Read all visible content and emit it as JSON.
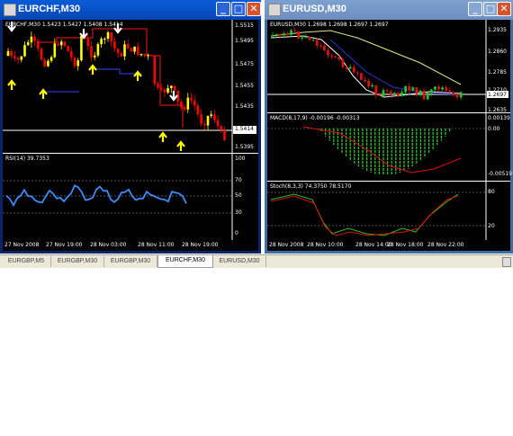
{
  "left_window": {
    "title": "EURCHF,M30",
    "price_pane": {
      "header": "EURCHF,M30  1.5423  1.5427  1.5408  1.5414",
      "price_axis": [
        "1.5515",
        "1.5495",
        "1.5475",
        "1.5455",
        "1.5435",
        "1.5414",
        "1.5395"
      ],
      "current_price": "1.5414"
    },
    "rsi_pane": {
      "header": "RSI(14) 39.7353",
      "axis": [
        "100",
        "70",
        "50",
        "30",
        "0"
      ]
    },
    "time_axis": [
      "27 Nov 2008",
      "27 Nov 19:00",
      "28 Nov 03:00",
      "28 Nov 11:00",
      "28 Nov 19:00"
    ]
  },
  "right_window": {
    "title": "EURUSD,M30",
    "price_pane": {
      "header": "EURUSD,M30  1.2698  1.2698  1.2697  1.2697",
      "price_axis": [
        "1.2935",
        "1.2860",
        "1.2785",
        "1.2710",
        "1.2697",
        "1.2635"
      ],
      "current_price": "1.2697"
    },
    "macd_pane": {
      "header": "MACD(8,17,9) -0.00196 -0.00313",
      "axis": [
        "0.00139",
        "0.00",
        "-0.00519"
      ]
    },
    "stoch_pane": {
      "header": "Stoch(8,3,3) 74.3750 78.5170",
      "axis": [
        "80",
        "20"
      ]
    },
    "time_axis": [
      "28 Nov 2008",
      "28 Nov 10:00",
      "28 Nov 14:00",
      "28 Nov 18:00",
      "28 Nov 22:00"
    ]
  },
  "window_buttons": {
    "minimize": "_",
    "maximize": "□",
    "close": "✕"
  },
  "tabs": [
    {
      "label": "EURGBP,M5",
      "active": false
    },
    {
      "label": "EURGBP,M30",
      "active": false
    },
    {
      "label": "EURGBP,M30",
      "active": false
    },
    {
      "label": "EURCHF,M30",
      "active": true
    },
    {
      "label": "EURUSD,M30",
      "active": false
    }
  ],
  "colors": {
    "bull": "#ffff00",
    "bear": "#ff0000",
    "rsi": "#3c8cff",
    "macd_hist": "#2ec42e",
    "ma_white": "#ffffff",
    "ma_blue": "#2a36d0",
    "ma_yellow": "#e6e68c"
  }
}
